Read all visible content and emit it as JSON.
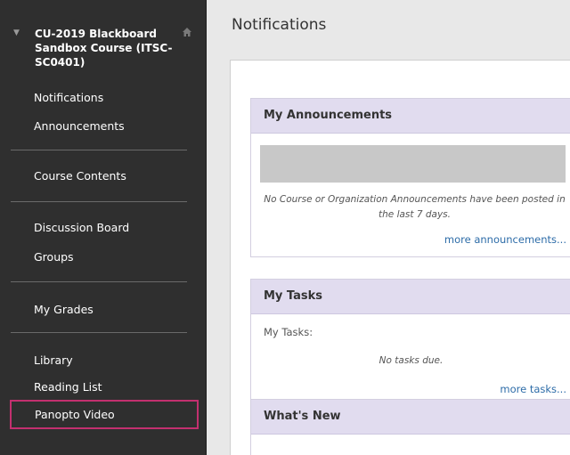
{
  "sidebar": {
    "course_title": "CU-2019 Blackboard Sandbox Course (ITSC-SC0401)",
    "items": [
      {
        "label": "Notifications"
      },
      {
        "label": "Announcements"
      },
      {
        "label": "Course Contents"
      },
      {
        "label": "Discussion Board"
      },
      {
        "label": "Groups"
      },
      {
        "label": "My Grades"
      },
      {
        "label": "Library"
      },
      {
        "label": "Reading List"
      },
      {
        "label": "Panopto Video"
      }
    ]
  },
  "main": {
    "page_title": "Notifications",
    "announcements": {
      "title": "My Announcements",
      "empty_message": "No Course or Organization Announcements have been posted in the last 7 days.",
      "more_link": "more announcements..."
    },
    "tasks": {
      "title": "My Tasks",
      "label": "My Tasks:",
      "empty_message": "No tasks due.",
      "more_link": "more tasks..."
    },
    "whats_new": {
      "title": "What's New"
    }
  },
  "colors": {
    "sidebar_bg": "#2f2f2f",
    "module_header_bg": "#e1dcef",
    "highlight_border": "#c3306f",
    "link": "#2d6ca8"
  },
  "icons": {
    "collapse": "caret-down-icon",
    "home": "home-icon"
  }
}
